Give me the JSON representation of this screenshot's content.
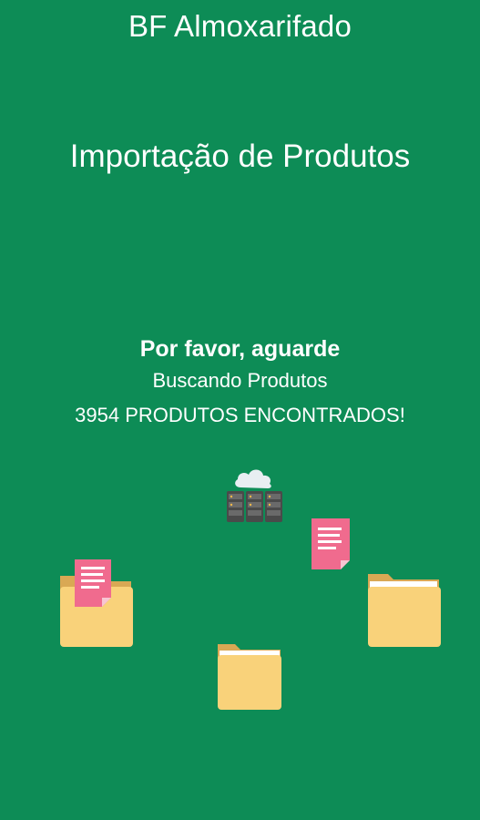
{
  "header": {
    "app_title": "BF Almoxarifado"
  },
  "page": {
    "title": "Importação de Produtos"
  },
  "status": {
    "wait_message": "Por favor, aguarde",
    "search_status": "Buscando Produtos",
    "found_count": "3954 PRODUTOS ENCONTRADOS!"
  },
  "icons": {
    "server": "cloud-server-icon",
    "folder": "folder-icon",
    "document": "document-icon"
  },
  "colors": {
    "background": "#0d8c56",
    "folder": "#f9d27a",
    "folder_back": "#d9a854",
    "document": "#f06b8e",
    "server": "#4a4a4a"
  }
}
